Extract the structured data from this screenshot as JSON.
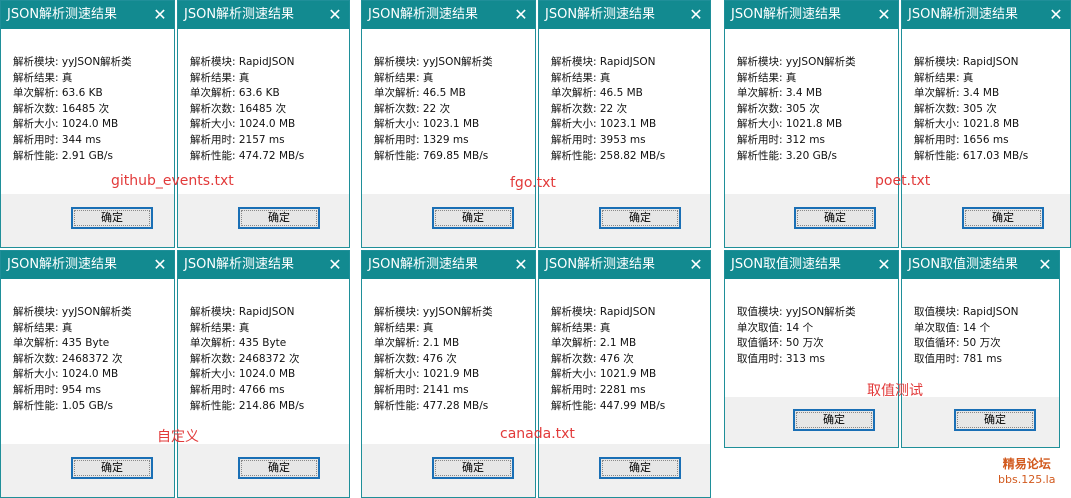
{
  "title_parse": "JSON解析测速结果",
  "title_get": "JSON取值测速结果",
  "ok_label": "确定",
  "close_glyph": "✕",
  "dialogs": [
    {
      "title": "JSON解析测速结果",
      "lines": [
        "解析模块: yyJSON解析类",
        "解析结果: 真",
        "单次解析: 63.6 KB",
        "解析次数: 16485 次",
        "解析大小: 1024.0 MB",
        "解析用时: 344 ms",
        "解析性能: 2.91 GB/s"
      ]
    },
    {
      "title": "JSON解析测速结果",
      "lines": [
        "解析模块: RapidJSON",
        "解析结果: 真",
        "单次解析: 63.6 KB",
        "解析次数: 16485 次",
        "解析大小: 1024.0 MB",
        "解析用时: 2157 ms",
        "解析性能: 474.72 MB/s"
      ]
    },
    {
      "title": "JSON解析测速结果",
      "lines": [
        "解析模块: yyJSON解析类",
        "解析结果: 真",
        "单次解析: 46.5 MB",
        "解析次数: 22 次",
        "解析大小: 1023.1 MB",
        "解析用时: 1329 ms",
        "解析性能: 769.85 MB/s"
      ]
    },
    {
      "title": "JSON解析测速结果",
      "lines": [
        "解析模块: RapidJSON",
        "解析结果: 真",
        "单次解析: 46.5 MB",
        "解析次数: 22 次",
        "解析大小: 1023.1 MB",
        "解析用时: 3953 ms",
        "解析性能: 258.82 MB/s"
      ]
    },
    {
      "title": "JSON解析测速结果",
      "lines": [
        "解析模块: yyJSON解析类",
        "解析结果: 真",
        "单次解析: 3.4 MB",
        "解析次数: 305 次",
        "解析大小: 1021.8 MB",
        "解析用时: 312 ms",
        "解析性能: 3.20 GB/s"
      ]
    },
    {
      "title": "JSON解析测速结果",
      "lines": [
        "解析模块: RapidJSON",
        "解析结果: 真",
        "单次解析: 3.4 MB",
        "解析次数: 305 次",
        "解析大小: 1021.8 MB",
        "解析用时: 1656 ms",
        "解析性能: 617.03 MB/s"
      ]
    },
    {
      "title": "JSON解析测速结果",
      "lines": [
        "解析模块: yyJSON解析类",
        "解析结果: 真",
        "单次解析: 435 Byte",
        "解析次数: 2468372 次",
        "解析大小: 1024.0 MB",
        "解析用时: 954 ms",
        "解析性能: 1.05 GB/s"
      ]
    },
    {
      "title": "JSON解析测速结果",
      "lines": [
        "解析模块: RapidJSON",
        "解析结果: 真",
        "单次解析: 435 Byte",
        "解析次数: 2468372 次",
        "解析大小: 1024.0 MB",
        "解析用时: 4766 ms",
        "解析性能: 214.86 MB/s"
      ]
    },
    {
      "title": "JSON解析测速结果",
      "lines": [
        "解析模块: yyJSON解析类",
        "解析结果: 真",
        "单次解析: 2.1 MB",
        "解析次数: 476 次",
        "解析大小: 1021.9 MB",
        "解析用时: 2141 ms",
        "解析性能: 477.28 MB/s"
      ]
    },
    {
      "title": "JSON解析测速结果",
      "lines": [
        "解析模块: RapidJSON",
        "解析结果: 真",
        "单次解析: 2.1 MB",
        "解析次数: 476 次",
        "解析大小: 1021.9 MB",
        "解析用时: 2281 ms",
        "解析性能: 447.99 MB/s"
      ]
    },
    {
      "title": "JSON取值测速结果",
      "lines": [
        "取值模块: yyJSON解析类",
        "单次取值: 14 个",
        "取值循环: 50 万次",
        "取值用时: 313 ms"
      ]
    },
    {
      "title": "JSON取值测速结果",
      "lines": [
        "取值模块: RapidJSON",
        "单次取值: 14 个",
        "取值循环: 50 万次",
        "取值用时: 781 ms"
      ]
    }
  ],
  "captions": [
    "github_events.txt",
    "fgo.txt",
    "poet.txt",
    "自定义",
    "canada.txt",
    "取值测试"
  ],
  "watermark": {
    "name": "精易论坛",
    "url": "bbs.125.la"
  },
  "colors": {
    "titlebar": "#128a90",
    "caption": "#e23a3a",
    "button_border": "#1a6fb5"
  }
}
